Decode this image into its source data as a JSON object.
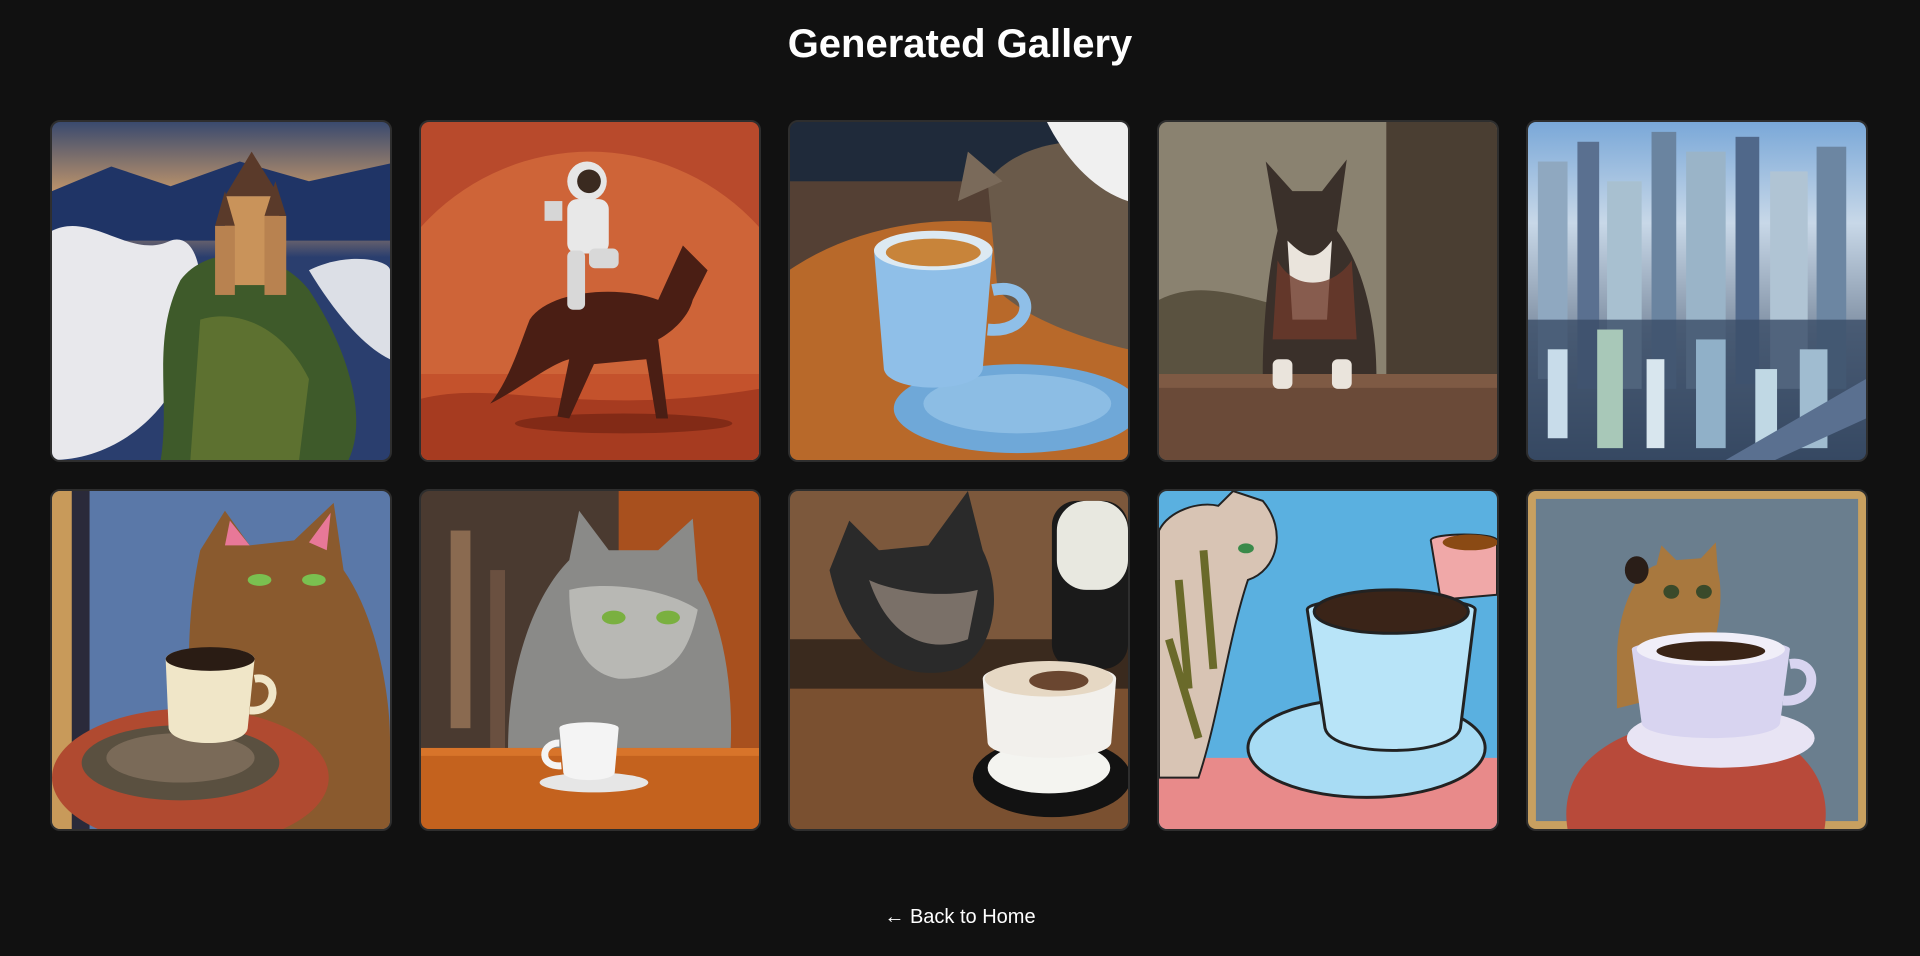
{
  "page": {
    "title": "Generated Gallery",
    "back_link": "← Back to Home"
  },
  "gallery": {
    "images": [
      {
        "subject": "castle-above-clouds"
      },
      {
        "subject": "astronaut-riding-horse-on-mars"
      },
      {
        "subject": "cat-with-coffee-cup"
      },
      {
        "subject": "dog-portrait-painting"
      },
      {
        "subject": "futuristic-city"
      },
      {
        "subject": "cat-painting-with-coffee"
      },
      {
        "subject": "tabby-cat-with-espresso"
      },
      {
        "subject": "kitten-with-latte"
      },
      {
        "subject": "cartoon-cat-with-coffee"
      },
      {
        "subject": "kitten-behind-teacup"
      }
    ]
  }
}
